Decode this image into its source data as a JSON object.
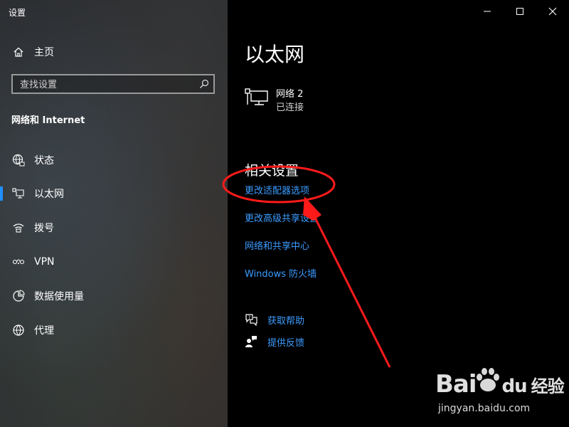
{
  "window": {
    "title": "设置",
    "controls": {
      "minimize": "minimize-icon",
      "maximize": "maximize-icon",
      "close": "close-icon"
    }
  },
  "sidebar": {
    "home_label": "主页",
    "search": {
      "placeholder": "查找设置",
      "value": ""
    },
    "section_title": "网络和 Internet",
    "items": [
      {
        "label": "状态",
        "icon": "globe-status-icon",
        "selected": false
      },
      {
        "label": "以太网",
        "icon": "ethernet-icon",
        "selected": true
      },
      {
        "label": "拨号",
        "icon": "dialup-icon",
        "selected": false
      },
      {
        "label": "VPN",
        "icon": "vpn-icon",
        "selected": false
      },
      {
        "label": "数据使用量",
        "icon": "data-usage-icon",
        "selected": false
      },
      {
        "label": "代理",
        "icon": "globe-icon",
        "selected": false
      }
    ]
  },
  "main": {
    "title": "以太网",
    "network": {
      "name": "网络 2",
      "status": "已连接"
    },
    "related_title": "相关设置",
    "links": [
      "更改适配器选项",
      "更改高级共享设置",
      "网络和共享中心",
      "Windows 防火墙"
    ],
    "help": [
      {
        "label": "获取帮助",
        "icon": "help-chat-icon"
      },
      {
        "label": "提供反馈",
        "icon": "feedback-icon"
      }
    ]
  },
  "watermark": {
    "brand": "Bai",
    "brand_du": "du",
    "brand_suffix": "经验",
    "url": "jingyan.baidu.com"
  },
  "colors": {
    "accent": "#3c9cff",
    "selection": "#1e90ff",
    "annotation": "#ff1a1a",
    "background": "#000000"
  }
}
